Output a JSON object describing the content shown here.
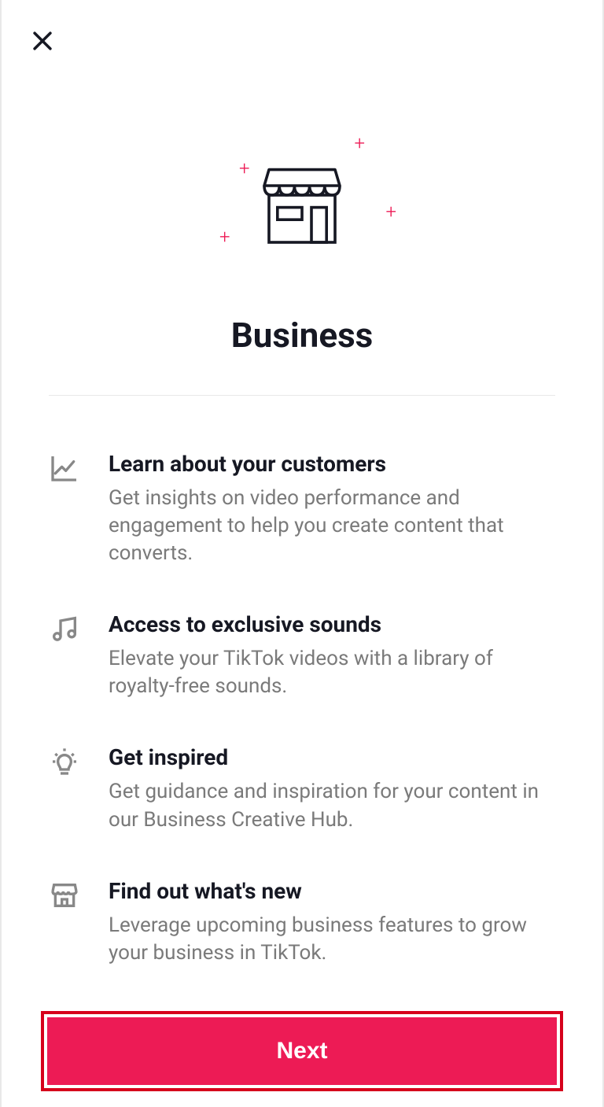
{
  "page_title": "Business",
  "features": [
    {
      "icon": "chart-line-icon",
      "title": "Learn about your customers",
      "description": "Get insights on video performance and engagement to help you create content that converts."
    },
    {
      "icon": "music-note-icon",
      "title": "Access to exclusive sounds",
      "description": "Elevate your TikTok videos with a library of royalty-free sounds."
    },
    {
      "icon": "lightbulb-icon",
      "title": "Get inspired",
      "description": "Get guidance and inspiration for your content in our Business Creative Hub."
    },
    {
      "icon": "storefront-icon",
      "title": "Find out what's new",
      "description": "Leverage upcoming business features to grow your business in TikTok."
    }
  ],
  "next_button_label": "Next"
}
